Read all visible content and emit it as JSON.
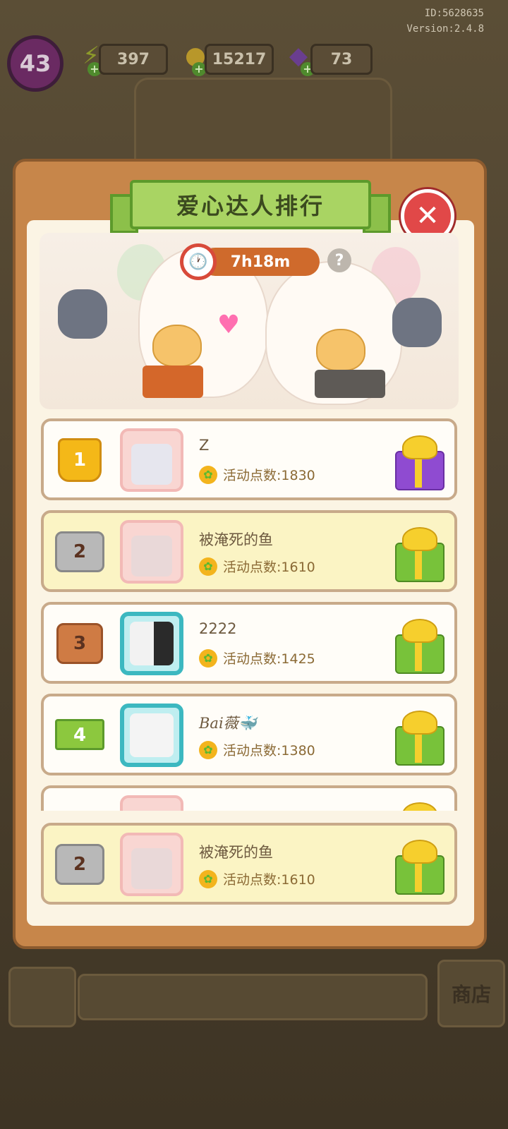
{
  "meta": {
    "id_text": "ID:5628635",
    "version_text": "Version:2.4.8"
  },
  "status_bar": {
    "level": "43",
    "energy": "397",
    "coins": "15217",
    "gems": "73"
  },
  "dialog": {
    "title": "爱心达人排行",
    "timer": "7h18m",
    "help_label": "?",
    "close_label": "✕"
  },
  "rankings": [
    {
      "rank": "1",
      "name": "Z",
      "points": "活动点数:1830",
      "gift_color": "#8f4bd1"
    },
    {
      "rank": "2",
      "name": "被淹死的鱼",
      "points": "活动点数:1610",
      "gift_color": "#78c23a"
    },
    {
      "rank": "3",
      "name": "2222",
      "points": "活动点数:1425",
      "gift_color": "#78c23a"
    },
    {
      "rank": "4",
      "name": "Bai薇🐳",
      "points": "活动点数:1380",
      "gift_color": "#78c23a"
    }
  ],
  "my_rank": {
    "rank": "2",
    "name": "被淹死的鱼",
    "points": "活动点数:1610"
  },
  "background": {
    "shop_label": "商店"
  }
}
